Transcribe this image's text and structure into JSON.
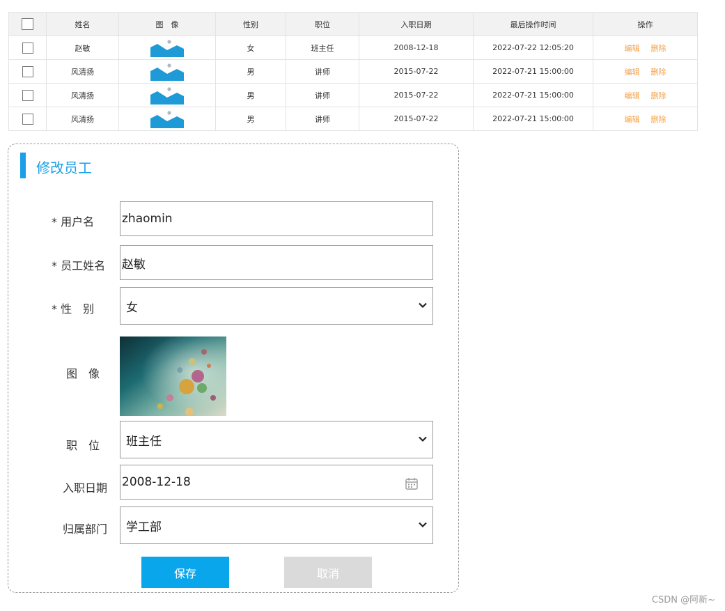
{
  "table": {
    "headers": [
      "",
      "姓名",
      "图　像",
      "性别",
      "职位",
      "入职日期",
      "最后操作时间",
      "操作"
    ],
    "rows": [
      {
        "name": "赵敏",
        "gender": "女",
        "position": "班主任",
        "entry_date": "2008-12-18",
        "update_time": "2022-07-22 12:05:20",
        "edit": "编辑",
        "delete": "删除"
      },
      {
        "name": "风清扬",
        "gender": "男",
        "position": "讲师",
        "entry_date": "2015-07-22",
        "update_time": "2022-07-21 15:00:00",
        "edit": "编辑",
        "delete": "删除"
      },
      {
        "name": "风清扬",
        "gender": "男",
        "position": "讲师",
        "entry_date": "2015-07-22",
        "update_time": "2022-07-21 15:00:00",
        "edit": "编辑",
        "delete": "删除"
      },
      {
        "name": "风清扬",
        "gender": "男",
        "position": "讲师",
        "entry_date": "2015-07-22",
        "update_time": "2022-07-21 15:00:00",
        "edit": "编辑",
        "delete": "删除"
      }
    ]
  },
  "form": {
    "title": "修改员工",
    "username_label": "* 用户名",
    "username_value": "zhaomin",
    "name_label": "* 员工姓名",
    "name_value": "赵敏",
    "gender_label": "* 性　别",
    "gender_value": "女",
    "image_label": "图　像",
    "position_label": "职　位",
    "position_value": "班主任",
    "entry_date_label": "入职日期",
    "entry_date_value": "2008-12-18",
    "dept_label": "归属部门",
    "dept_value": "学工部",
    "save_label": "保存",
    "cancel_label": "取消"
  },
  "watermark": "CSDN @阿新~",
  "colors": {
    "accent": "#1aa0e8",
    "save_button": "#0aa6ec",
    "cancel_button": "#dadada",
    "action_link": "#f5a14a",
    "thumbnail": "#1e9ad6"
  },
  "icons": {
    "row_thumbnail": "image-placeholder-icon",
    "select_arrow": "chevron-down-icon",
    "date_picker": "calendar-icon"
  }
}
